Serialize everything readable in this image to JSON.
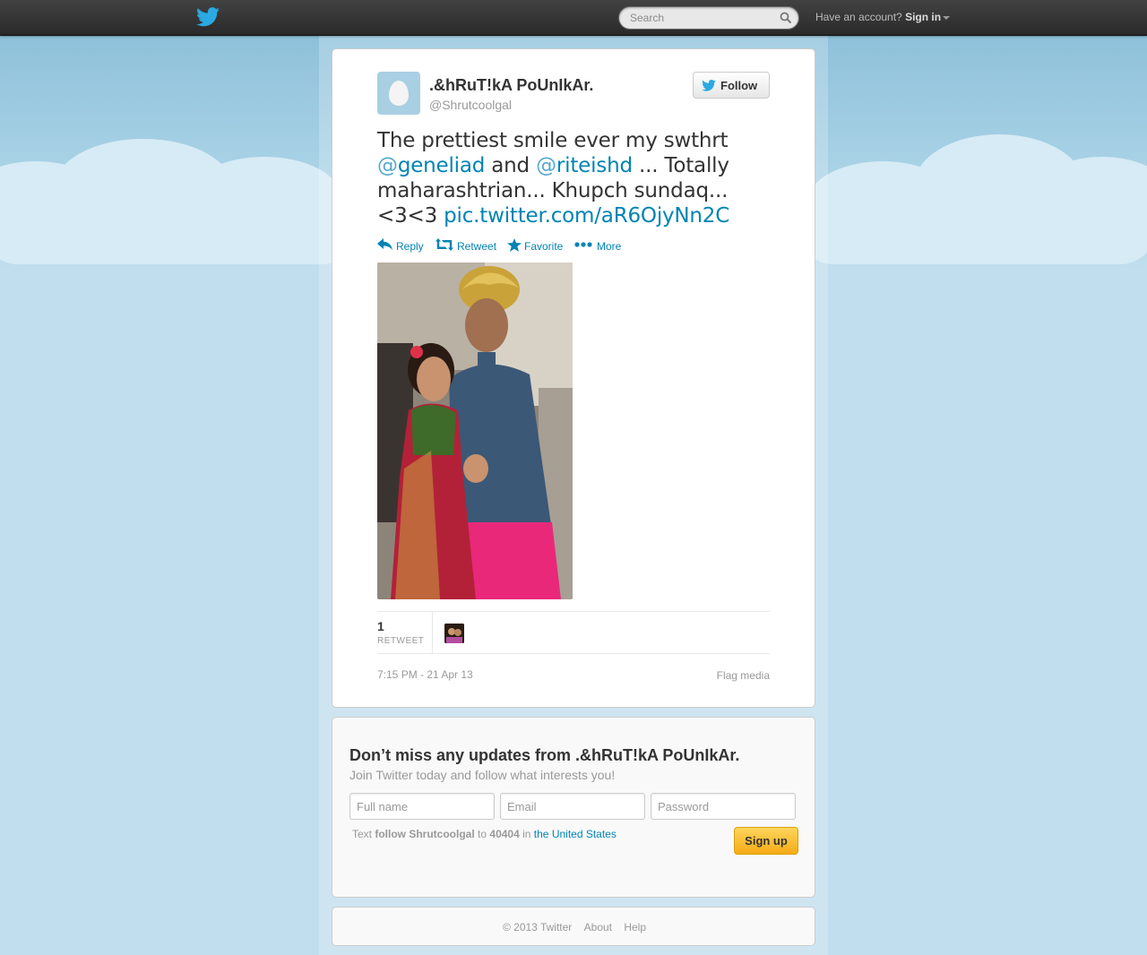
{
  "topbar": {
    "search_placeholder": "Search",
    "have_account": "Have an account?",
    "sign_in": "Sign in"
  },
  "tweet": {
    "display_name": ".&hRuT!kA PoUnIkAr.",
    "screen_name": "@Shrutcoolgal",
    "follow_label": "Follow",
    "text_part1": "The prettiest smile ever my swthrt ",
    "mention1_at": "@",
    "mention1_name": "geneliad",
    "text_and": " and ",
    "mention2_at": "@",
    "mention2_name": "riteishd",
    "text_part2": " ... Totally maharashtrian... Khupch sundaq... <3<3 ",
    "link": "pic.twitter.com/aR6OjyNn2C",
    "actions": {
      "reply": "Reply",
      "retweet": "Retweet",
      "favorite": "Favorite",
      "more": "More"
    },
    "retweet_count": "1",
    "retweet_label": "RETWEET",
    "timestamp": "7:15 PM - 21 Apr 13",
    "flag_media": "Flag media"
  },
  "signup": {
    "title": "Don’t miss any updates from .&hRuT!kA PoUnIkAr.",
    "subtitle": "Join Twitter today and follow what interests you!",
    "full_name_placeholder": "Full name",
    "email_placeholder": "Email",
    "password_placeholder": "Password",
    "sms_text": "Text",
    "sms_command": "follow Shrutcoolgal",
    "sms_to": "to",
    "sms_number": "40404",
    "sms_in": "in",
    "sms_country": "the United States",
    "button": "Sign up"
  },
  "footer": {
    "copyright": "© 2013 Twitter",
    "about": "About",
    "help": "Help"
  },
  "colors": {
    "link": "#0084b4",
    "background": "#c0deed",
    "topbar": "#333333",
    "signup_button": "#f5ab16"
  }
}
